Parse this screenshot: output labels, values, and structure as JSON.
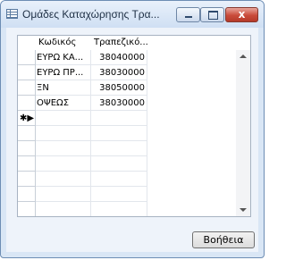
{
  "window": {
    "title": "Ομάδες Καταχώρησης Τρα...",
    "close_glyph": "x"
  },
  "grid": {
    "columns": [
      "Κωδικός",
      "Τραπεζικό..."
    ],
    "rows": [
      {
        "code": "ΕΥΡΩ ΚΑ...",
        "account": "38040000"
      },
      {
        "code": "ΕΥΡΩ ΠΡ...",
        "account": "38030000"
      },
      {
        "code": "ΞΝ",
        "account": "38050000"
      },
      {
        "code": "ΟΨΕΩΣ",
        "account": "38030000"
      }
    ],
    "new_row_marker": "✱▶"
  },
  "buttons": {
    "help": "Βοήθεια"
  }
}
